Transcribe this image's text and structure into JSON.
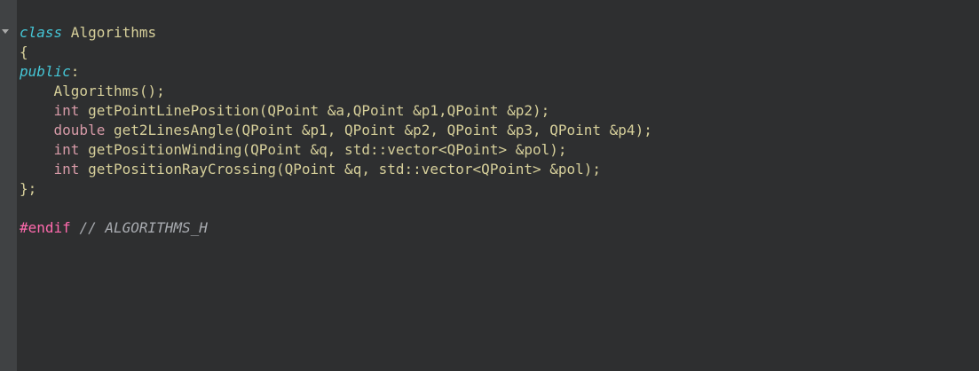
{
  "editor": {
    "lines": [
      [
        {
          "t": "class",
          "c": "kw-italic"
        },
        {
          "t": " Algorithms",
          "c": "plain"
        }
      ],
      [
        {
          "t": "{",
          "c": "punct"
        }
      ],
      [
        {
          "t": "public",
          "c": "kw-italic"
        },
        {
          "t": ":",
          "c": "punct"
        }
      ],
      [
        {
          "t": "    Algorithms();",
          "c": "plain"
        }
      ],
      [
        {
          "t": "    ",
          "c": "plain"
        },
        {
          "t": "int",
          "c": "kw-type"
        },
        {
          "t": " getPointLinePosition(QPoint &a,QPoint &p1,QPoint &p2);",
          "c": "plain"
        }
      ],
      [
        {
          "t": "    ",
          "c": "plain"
        },
        {
          "t": "double",
          "c": "kw-type"
        },
        {
          "t": " get2LinesAngle(QPoint &p1, QPoint &p2, QPoint &p3, QPoint &p4);",
          "c": "plain"
        }
      ],
      [
        {
          "t": "    ",
          "c": "plain"
        },
        {
          "t": "int",
          "c": "kw-type"
        },
        {
          "t": " getPositionWinding(QPoint &q, std::vector<QPoint> &pol);",
          "c": "plain"
        }
      ],
      [
        {
          "t": "    ",
          "c": "plain"
        },
        {
          "t": "int",
          "c": "kw-type"
        },
        {
          "t": " getPositionRayCrossing(QPoint &q, std::vector<QPoint> &pol);",
          "c": "plain"
        }
      ],
      [
        {
          "t": "};",
          "c": "punct"
        }
      ],
      [],
      [
        {
          "t": "#endif",
          "c": "preproc"
        },
        {
          "t": " ",
          "c": "plain"
        },
        {
          "t": "// ALGORITHMS_H",
          "c": "comment"
        }
      ]
    ]
  }
}
